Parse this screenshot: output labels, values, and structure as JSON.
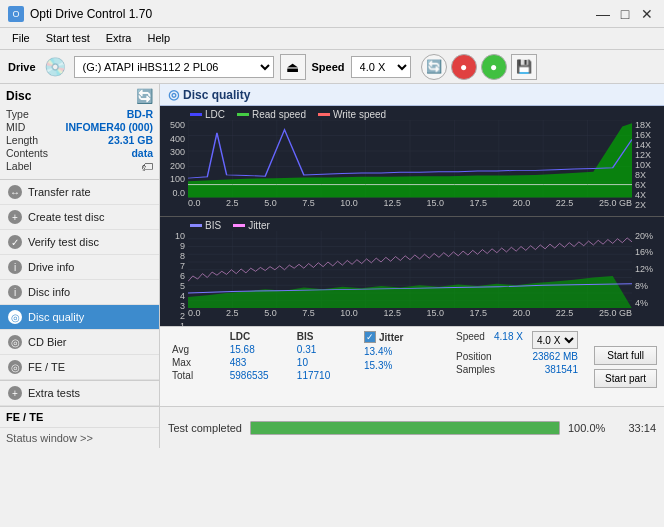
{
  "titleBar": {
    "title": "Opti Drive Control 1.70",
    "minimizeBtn": "—",
    "maximizeBtn": "□",
    "closeBtn": "✕"
  },
  "menuBar": {
    "items": [
      "File",
      "Start test",
      "Extra",
      "Help"
    ]
  },
  "toolbar": {
    "driveLabel": "Drive",
    "driveValue": "(G:)  ATAPI iHBS112  2 PL06",
    "speedLabel": "Speed",
    "speedValue": "4.0 X"
  },
  "discPanel": {
    "label": "Disc",
    "rows": [
      {
        "key": "Type",
        "val": "BD-R"
      },
      {
        "key": "MID",
        "val": "INFOMER40 (000)"
      },
      {
        "key": "Length",
        "val": "23.31 GB"
      },
      {
        "key": "Contents",
        "val": "data"
      },
      {
        "key": "Label",
        "val": ""
      }
    ]
  },
  "sidebar": {
    "items": [
      {
        "label": "Transfer rate",
        "active": false
      },
      {
        "label": "Create test disc",
        "active": false
      },
      {
        "label": "Verify test disc",
        "active": false
      },
      {
        "label": "Drive info",
        "active": false
      },
      {
        "label": "Disc info",
        "active": false
      },
      {
        "label": "Disc quality",
        "active": true
      },
      {
        "label": "CD Bier",
        "active": false
      },
      {
        "label": "FE / TE",
        "active": false
      },
      {
        "label": "Extra tests",
        "active": false
      }
    ]
  },
  "discQuality": {
    "title": "Disc quality",
    "topChart": {
      "legend": [
        "LDC",
        "Read speed",
        "Write speed"
      ],
      "yLeftLabels": [
        "500",
        "400",
        "300",
        "200",
        "100",
        "0.0"
      ],
      "yRightLabels": [
        "18X",
        "16X",
        "14X",
        "12X",
        "10X",
        "8X",
        "6X",
        "4X",
        "2X"
      ],
      "xLabels": [
        "0.0",
        "2.5",
        "5.0",
        "7.5",
        "10.0",
        "12.5",
        "15.0",
        "17.5",
        "20.0",
        "22.5",
        "25.0 GB"
      ]
    },
    "bottomChart": {
      "legend": [
        "BIS",
        "Jitter"
      ],
      "yLeftLabels": [
        "10",
        "9",
        "8",
        "7",
        "6",
        "5",
        "4",
        "3",
        "2",
        "1"
      ],
      "yRightLabels": [
        "20%",
        "16%",
        "12%",
        "8%",
        "4%"
      ],
      "xLabels": [
        "0.0",
        "2.5",
        "5.0",
        "7.5",
        "10.0",
        "12.5",
        "15.0",
        "17.5",
        "20.0",
        "22.5",
        "25.0 GB"
      ]
    }
  },
  "stats": {
    "columns": [
      "LDC",
      "BIS"
    ],
    "jitterLabel": "Jitter",
    "rows": [
      {
        "key": "Avg",
        "ldc": "15.68",
        "bis": "0.31",
        "jitter": "13.4%"
      },
      {
        "key": "Max",
        "ldc": "483",
        "bis": "10",
        "jitter": "15.3%"
      },
      {
        "key": "Total",
        "ldc": "5986535",
        "bis": "117710",
        "jitter": ""
      }
    ],
    "speedLabel": "Speed",
    "speedVal": "4.18 X",
    "speedSelect": "4.0 X",
    "positionLabel": "Position",
    "positionVal": "23862 MB",
    "samplesLabel": "Samples",
    "samplesVal": "381541",
    "startFullBtn": "Start full",
    "startPartBtn": "Start part"
  },
  "statusBar": {
    "completedText": "Test completed",
    "feTeLabel": "FE / TE",
    "statusWindowLabel": "Status window >>",
    "progressPercent": "100.0%",
    "progressValue": 100,
    "timeLabel": "33:14"
  }
}
